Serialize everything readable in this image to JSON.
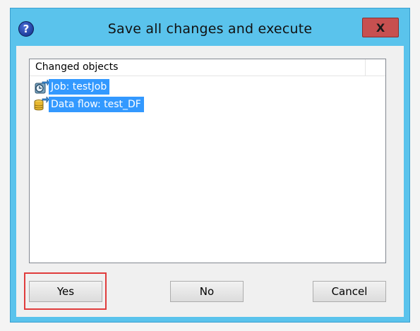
{
  "dialog": {
    "title": "Save all changes and execute",
    "help_icon": "question-circle-icon",
    "close_label": "X"
  },
  "list": {
    "column_header": "Changed objects",
    "items": [
      {
        "icon": "job-icon",
        "label": "Job: testJob"
      },
      {
        "icon": "data-flow-icon",
        "label": "Data flow: test_DF"
      }
    ]
  },
  "buttons": {
    "yes": "Yes",
    "no": "No",
    "cancel": "Cancel"
  },
  "colors": {
    "titlebar": "#5ac3ec",
    "selection": "#3399ff",
    "close": "#c75050",
    "highlight": "#e03c3c"
  }
}
